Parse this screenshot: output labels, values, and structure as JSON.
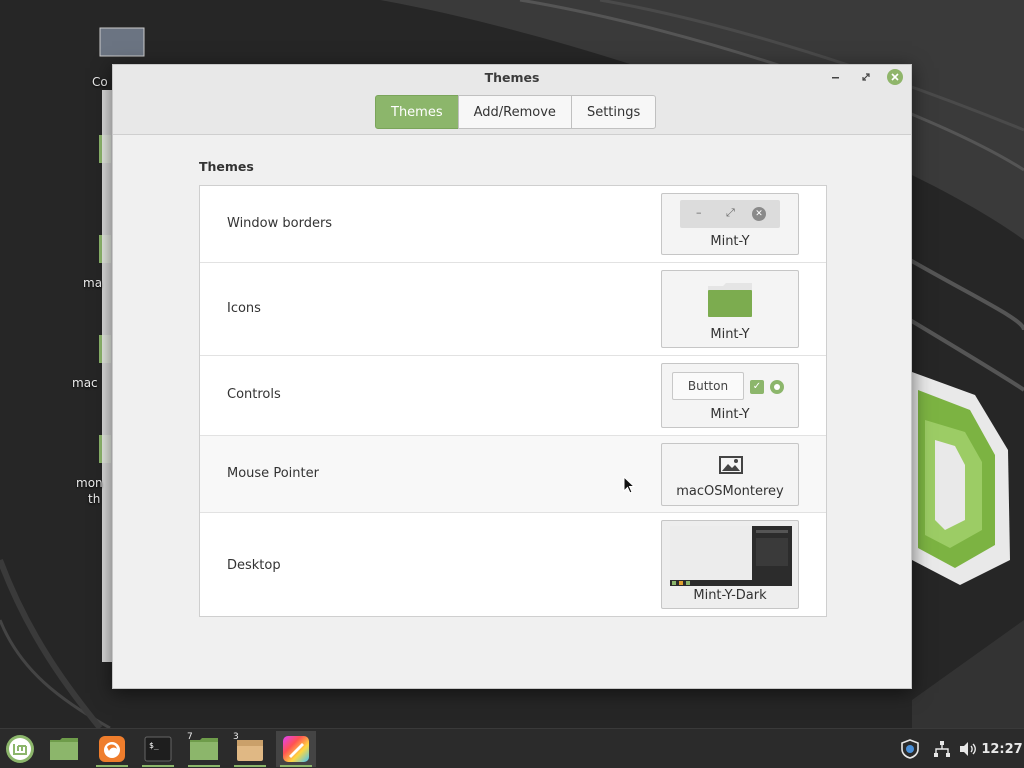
{
  "window": {
    "title": "Themes",
    "tabs": [
      {
        "label": "Themes",
        "active": true
      },
      {
        "label": "Add/Remove",
        "active": false
      },
      {
        "label": "Settings",
        "active": false
      }
    ]
  },
  "section_title": "Themes",
  "rows": [
    {
      "label": "Window borders",
      "theme": "Mint-Y"
    },
    {
      "label": "Icons",
      "theme": "Mint-Y"
    },
    {
      "label": "Controls",
      "theme": "Mint-Y",
      "preview_button": "Button"
    },
    {
      "label": "Mouse Pointer",
      "theme": "macOSMonterey"
    },
    {
      "label": "Desktop",
      "theme": "Mint-Y-Dark"
    }
  ],
  "desktop_labels": [
    "Co",
    "ma",
    "mac",
    "mon",
    "th"
  ],
  "panel": {
    "launchers": [
      {
        "icon": "mint-menu-icon"
      },
      {
        "icon": "files-icon"
      },
      {
        "icon": "firefox-icon"
      },
      {
        "icon": "terminal-icon"
      },
      {
        "icon": "folder-group-icon",
        "badge": "7"
      },
      {
        "icon": "archive-group-icon",
        "badge": "3"
      },
      {
        "icon": "themes-app-icon"
      }
    ],
    "clock": "12:27"
  },
  "colors": {
    "accent": "#8cb66b",
    "panel": "#2b2b2b",
    "window_bg": "#f0f0f0"
  }
}
